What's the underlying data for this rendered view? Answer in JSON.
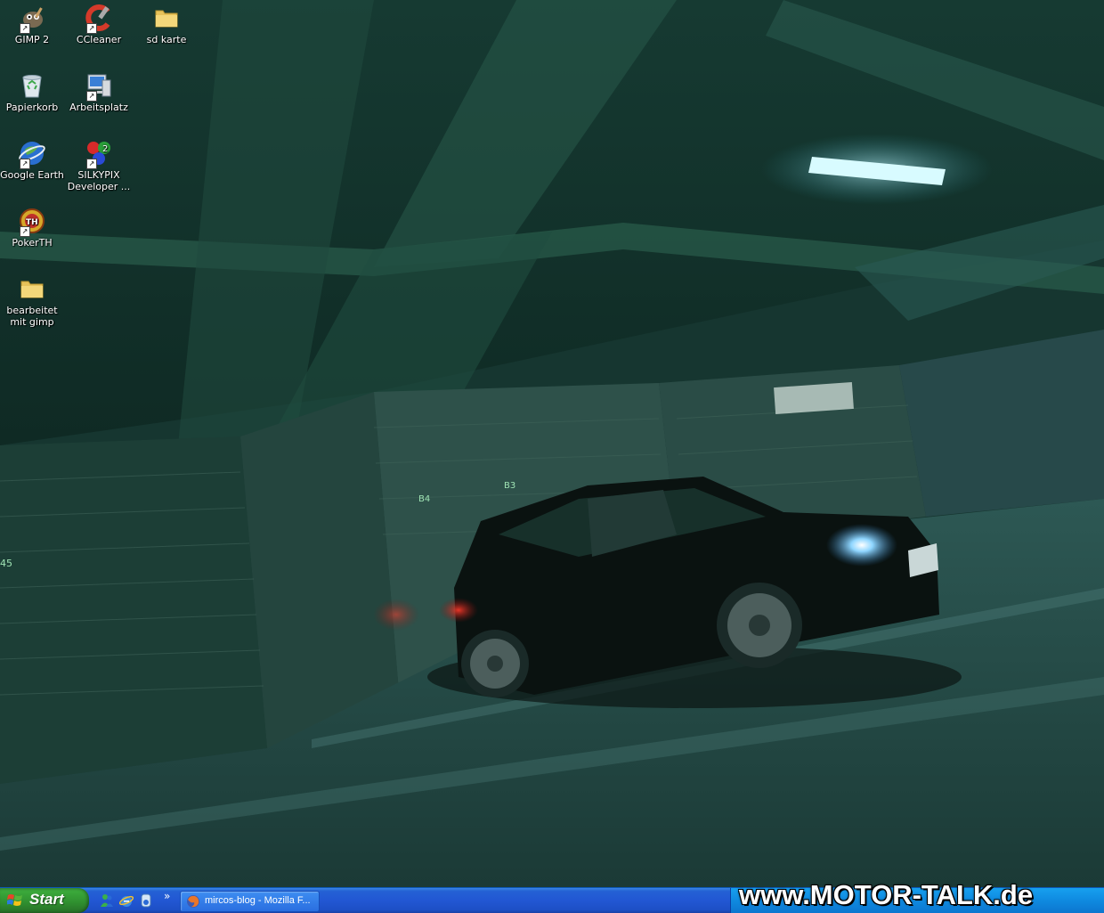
{
  "desktop": {
    "icons": [
      {
        "label": "GIMP 2",
        "icon": "gimp-icon",
        "shortcut": true
      },
      {
        "label": "CCleaner",
        "icon": "ccleaner-icon",
        "shortcut": true
      },
      {
        "label": "sd karte",
        "icon": "folder-icon",
        "shortcut": false
      },
      {
        "label": "Papierkorb",
        "icon": "recycle-bin-icon",
        "shortcut": false
      },
      {
        "label": "Arbeitsplatz",
        "icon": "my-computer-icon",
        "shortcut": true
      },
      {
        "label": "Google Earth",
        "icon": "google-earth-icon",
        "shortcut": true
      },
      {
        "label": "SILKYPIX Developer ...",
        "icon": "silkypix-icon",
        "shortcut": true
      },
      {
        "label": "PokerTH",
        "icon": "pokerth-icon",
        "shortcut": true
      },
      {
        "label": "bearbeitet mit gimp",
        "icon": "folder-icon",
        "shortcut": false
      }
    ],
    "wallpaper": {
      "signs": [
        "B4",
        "B3",
        "45"
      ]
    }
  },
  "taskbar": {
    "start_label": "Start",
    "quicklaunch": [
      "messenger-icon",
      "ie-icon",
      "media-player-icon"
    ],
    "overflow_glyph": "»",
    "tasks": [
      {
        "label": "mircos-blog - Mozilla F...",
        "icon": "firefox-icon"
      }
    ]
  },
  "watermark": "www.MOTOR-TALK.de",
  "colors": {
    "taskbar_blue": "#2257d3",
    "start_green": "#3aa83a",
    "tray_blue": "#0f8ae0",
    "wallpaper_tint": "#1e4a3c"
  }
}
